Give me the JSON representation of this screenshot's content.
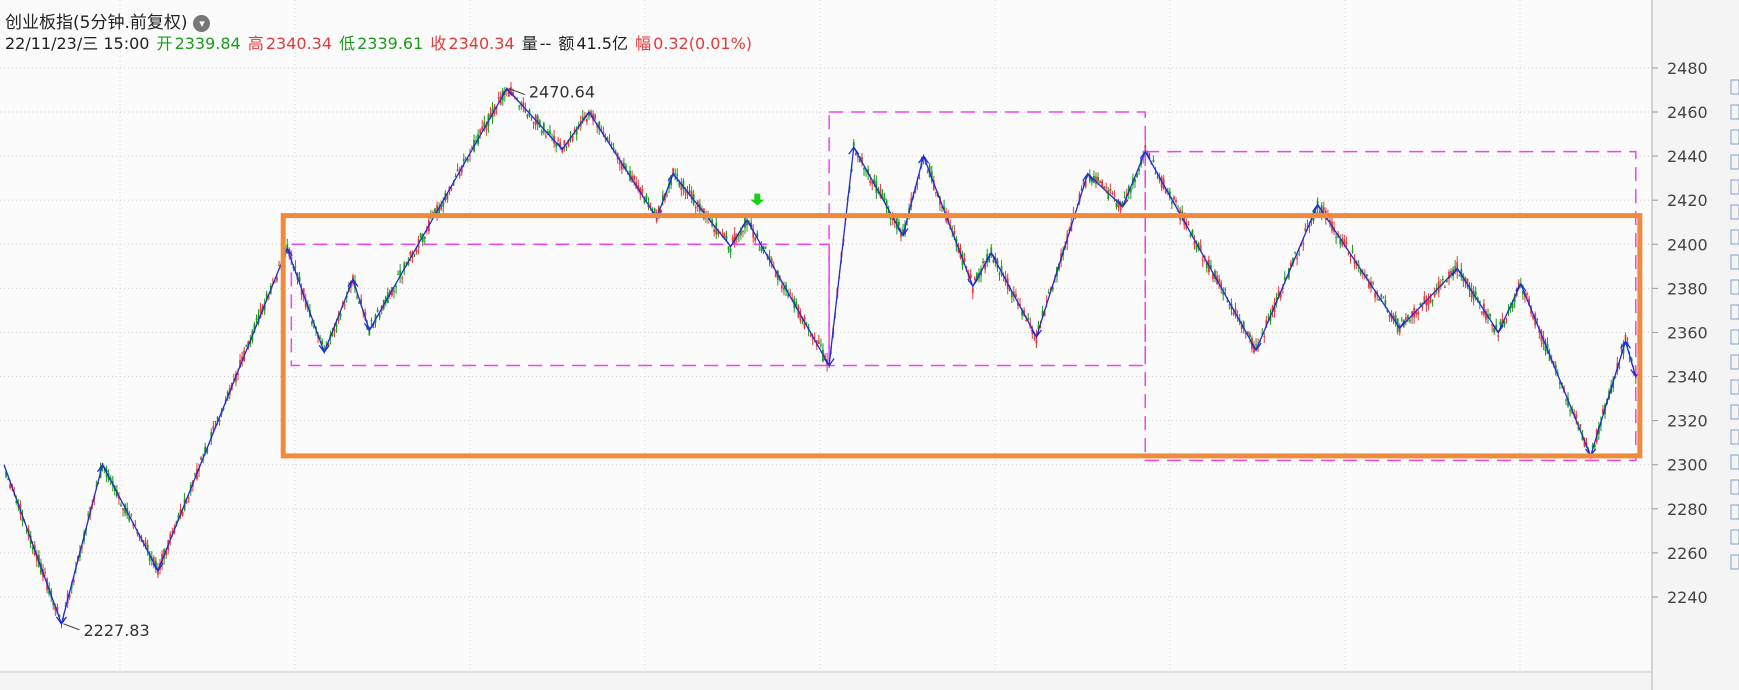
{
  "header": {
    "title": "创业板指(5分钟.前复权)",
    "date": "22/11/23/三 15:00",
    "open_label": "开",
    "open": "2339.84",
    "high_label": "高",
    "high": "2340.34",
    "low_label": "低",
    "low": "2339.61",
    "close_label": "收",
    "close": "2340.34",
    "volume_label": "量",
    "volume": "--",
    "amount_label": "额",
    "amount": "41.5亿",
    "change_label": "幅",
    "change": "0.32(0.01%)"
  },
  "colors": {
    "up": "#e33b3b",
    "down": "#1b9b1b",
    "zigzag": "#1f2fd6",
    "box_dash": "#ee44ee",
    "box_main": "#f08a3c",
    "marker": "#19d019"
  },
  "chart_data": {
    "type": "candlestick",
    "title": "创业板指(5分钟.前复权)",
    "ylim": [
      2220,
      2490
    ],
    "y_ticks": [
      2240,
      2260,
      2280,
      2300,
      2320,
      2340,
      2360,
      2380,
      2400,
      2420,
      2440,
      2460,
      2480
    ],
    "zigzag": [
      {
        "i": 0,
        "v": 2300
      },
      {
        "i": 28,
        "v": 2227.83
      },
      {
        "i": 48,
        "v": 2300
      },
      {
        "i": 75,
        "v": 2252
      },
      {
        "i": 138,
        "v": 2398
      },
      {
        "i": 156,
        "v": 2351
      },
      {
        "i": 170,
        "v": 2384
      },
      {
        "i": 178,
        "v": 2361
      },
      {
        "i": 245,
        "v": 2470.64
      },
      {
        "i": 272,
        "v": 2443
      },
      {
        "i": 285,
        "v": 2460
      },
      {
        "i": 318,
        "v": 2412
      },
      {
        "i": 326,
        "v": 2432
      },
      {
        "i": 354,
        "v": 2399
      },
      {
        "i": 362,
        "v": 2411
      },
      {
        "i": 402,
        "v": 2345
      },
      {
        "i": 414,
        "v": 2444
      },
      {
        "i": 438,
        "v": 2404
      },
      {
        "i": 448,
        "v": 2440
      },
      {
        "i": 472,
        "v": 2381
      },
      {
        "i": 481,
        "v": 2396
      },
      {
        "i": 503,
        "v": 2358
      },
      {
        "i": 528,
        "v": 2432
      },
      {
        "i": 545,
        "v": 2417
      },
      {
        "i": 556,
        "v": 2442
      },
      {
        "i": 610,
        "v": 2352
      },
      {
        "i": 640,
        "v": 2418
      },
      {
        "i": 680,
        "v": 2362
      },
      {
        "i": 708,
        "v": 2389
      },
      {
        "i": 728,
        "v": 2360
      },
      {
        "i": 739,
        "v": 2382
      },
      {
        "i": 773,
        "v": 2304
      },
      {
        "i": 790,
        "v": 2356
      },
      {
        "i": 795,
        "v": 2340
      }
    ],
    "annotations": [
      {
        "text": "2470.64",
        "i": 245,
        "v": 2470.64
      },
      {
        "text": "2227.83",
        "i": 28,
        "v": 2227.83
      }
    ],
    "boxes_dashed": [
      {
        "i0": 140,
        "i1": 402,
        "v0": 2345,
        "v1": 2400
      },
      {
        "i0": 402,
        "i1": 556,
        "v0": 2345,
        "v1": 2460
      },
      {
        "i0": 556,
        "i1": 795,
        "v0": 2302,
        "v1": 2442
      }
    ],
    "box_main": {
      "i0": 137,
      "i1": 796,
      "v0": 2304,
      "v1": 2413
    },
    "marker": {
      "i": 367,
      "v": 2413
    },
    "last_price": 2340.34
  }
}
